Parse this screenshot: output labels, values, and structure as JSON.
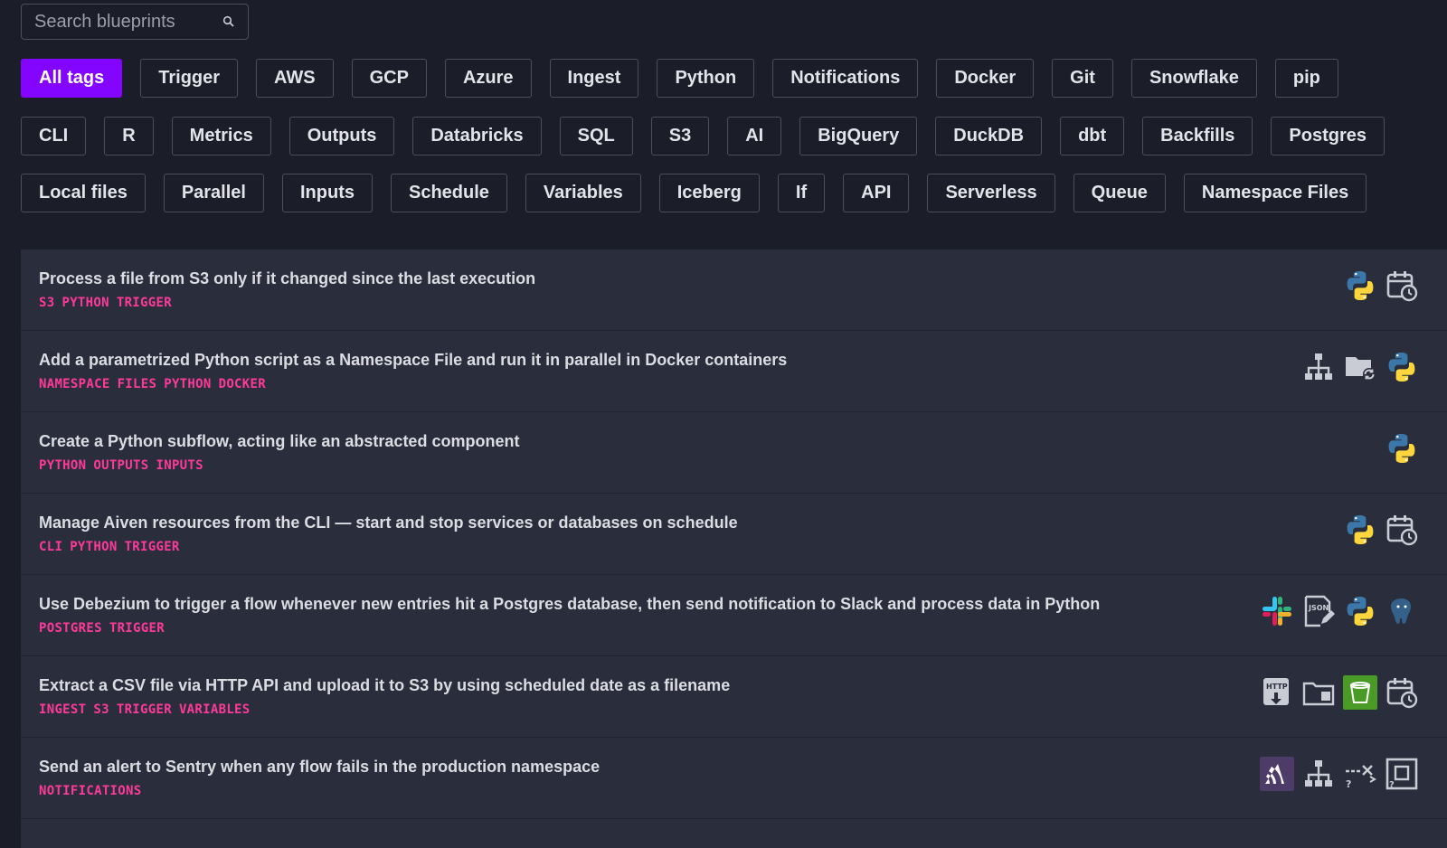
{
  "search": {
    "placeholder": "Search blueprints"
  },
  "tag_rows": [
    [
      "All tags",
      "Trigger",
      "AWS",
      "GCP",
      "Azure",
      "Ingest",
      "Python",
      "Notifications",
      "Docker",
      "Git",
      "Snowflake",
      "pip"
    ],
    [
      "CLI",
      "R",
      "Metrics",
      "Outputs",
      "Databricks",
      "SQL",
      "S3",
      "AI",
      "BigQuery",
      "DuckDB",
      "dbt",
      "Backfills",
      "Postgres"
    ],
    [
      "Local files",
      "Parallel",
      "Inputs",
      "Schedule",
      "Variables",
      "Iceberg",
      "If",
      "API",
      "Serverless",
      "Queue",
      "Namespace Files"
    ]
  ],
  "active_tag": "All tags",
  "colors": {
    "accent": "#8405ff",
    "tag_text": "#fd3a9a",
    "background": "#1b1e29",
    "card": "#2a2e3c"
  },
  "blueprints": [
    {
      "title": "Process a file from S3 only if it changed since the last execution",
      "tags": [
        "S3",
        "PYTHON",
        "TRIGGER"
      ],
      "icons": [
        "python-icon",
        "schedule-icon"
      ]
    },
    {
      "title": "Add a parametrized Python script as a Namespace File and run it in parallel in Docker containers",
      "tags": [
        "NAMESPACE",
        "FILES",
        "PYTHON",
        "DOCKER"
      ],
      "icons": [
        "parallel-icon",
        "namespace-files-icon",
        "python-icon"
      ]
    },
    {
      "title": "Create a Python subflow, acting like an abstracted component",
      "tags": [
        "PYTHON",
        "OUTPUTS",
        "INPUTS"
      ],
      "icons": [
        "python-icon"
      ]
    },
    {
      "title": "Manage Aiven resources from the CLI — start and stop services or databases on schedule",
      "tags": [
        "CLI",
        "PYTHON",
        "TRIGGER"
      ],
      "icons": [
        "python-icon",
        "schedule-icon"
      ]
    },
    {
      "title": "Use Debezium to trigger a flow whenever new entries hit a Postgres database, then send notification to Slack and process data in Python",
      "tags": [
        "POSTGRES",
        "TRIGGER"
      ],
      "icons": [
        "slack-icon",
        "json-icon",
        "python-icon",
        "postgres-icon"
      ]
    },
    {
      "title": "Extract a CSV file via HTTP API and upload it to S3 by using scheduled date as a filename",
      "tags": [
        "INGEST",
        "S3",
        "TRIGGER",
        "VARIABLES"
      ],
      "icons": [
        "http-download-icon",
        "local-file-icon",
        "s3-bucket-icon",
        "schedule-icon"
      ]
    },
    {
      "title": "Send an alert to Sentry when any flow fails in the production namespace",
      "tags": [
        "NOTIFICATIONS"
      ],
      "icons": [
        "sentry-icon",
        "parallel-icon",
        "switch-icon",
        "subflow-icon"
      ]
    }
  ]
}
